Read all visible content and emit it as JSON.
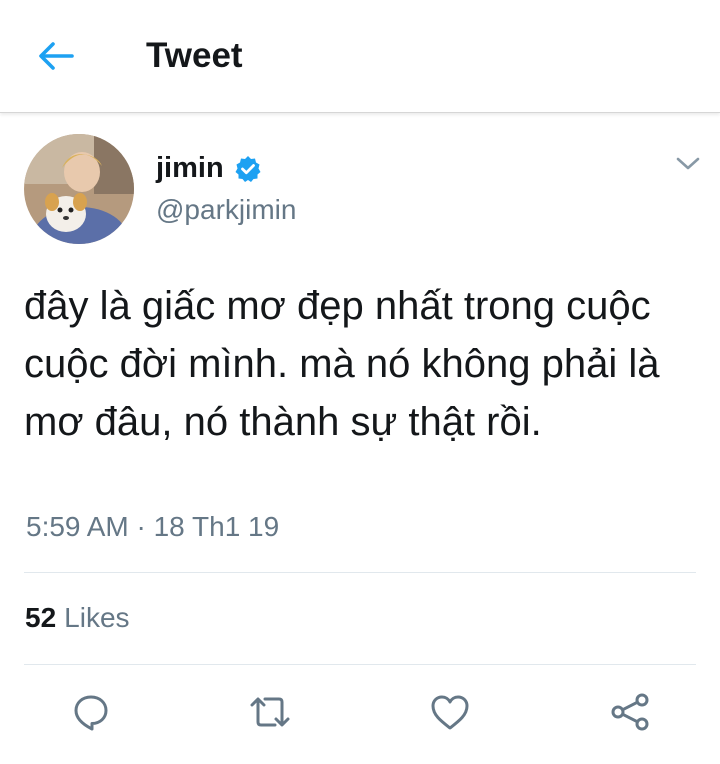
{
  "header": {
    "title": "Tweet",
    "back_icon": "arrow-left-icon",
    "accent_color": "#1da1f2"
  },
  "tweet": {
    "author": {
      "display_name": "jimin",
      "handle": "@parkjimin",
      "verified": true,
      "verified_icon": "verified-badge-icon"
    },
    "text": "đây là giấc mơ đẹp nhất trong cuộc cuộc đời mình. mà nó không phải là mơ đâu, nó thành sự thật rồi.",
    "timestamp": "5:59 AM · 18 Th1 19",
    "menu_icon": "chevron-down-icon"
  },
  "stats": {
    "likes_count": "52",
    "likes_label": "Likes"
  },
  "actions": [
    {
      "name": "reply",
      "icon": "reply-icon"
    },
    {
      "name": "retweet",
      "icon": "retweet-icon"
    },
    {
      "name": "like",
      "icon": "heart-icon"
    },
    {
      "name": "share",
      "icon": "share-icon"
    }
  ],
  "colors": {
    "primary_text": "#14171a",
    "secondary_text": "#657786",
    "divider": "#e1e8ed",
    "verified": "#1da1f2"
  }
}
